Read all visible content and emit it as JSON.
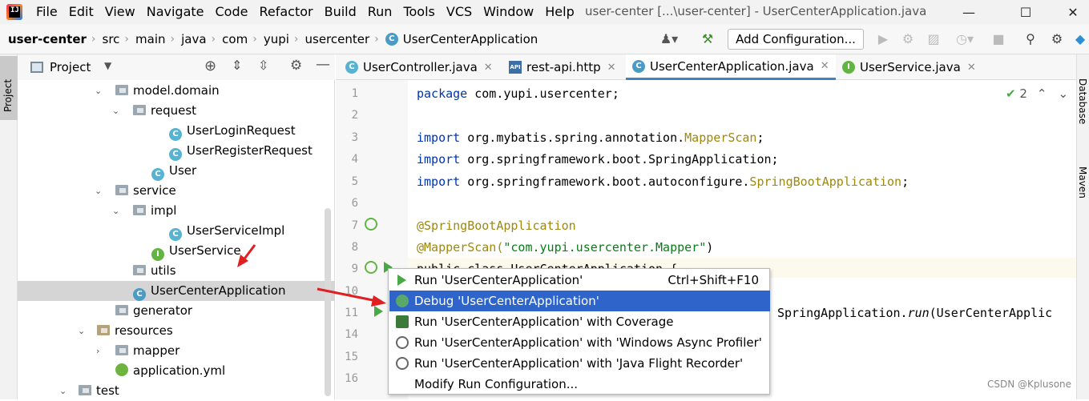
{
  "menubar": {
    "items": [
      "File",
      "Edit",
      "View",
      "Navigate",
      "Code",
      "Refactor",
      "Build",
      "Run",
      "Tools",
      "VCS",
      "Window",
      "Help"
    ],
    "window_title": "user-center [...\\user-center] - UserCenterApplication.java"
  },
  "navbar": {
    "crumbs": [
      "user-center",
      "src",
      "main",
      "java",
      "com",
      "yupi",
      "usercenter",
      "UserCenterApplication"
    ],
    "add_configuration": "Add Configuration..."
  },
  "left_stripe": {
    "project_tab": "Project"
  },
  "project_panel": {
    "title": "Project",
    "tree": [
      {
        "label": "model.domain",
        "icon": "folder-icon",
        "expanded": true
      },
      {
        "label": "request",
        "icon": "folder-icon",
        "expanded": true
      },
      {
        "label": "UserLoginRequest",
        "icon": "class-icon"
      },
      {
        "label": "UserRegisterRequest",
        "icon": "class-icon"
      },
      {
        "label": "User",
        "icon": "class-icon"
      },
      {
        "label": "service",
        "icon": "folder-icon",
        "expanded": true
      },
      {
        "label": "impl",
        "icon": "folder-icon",
        "expanded": true
      },
      {
        "label": "UserServiceImpl",
        "icon": "class-icon"
      },
      {
        "label": "UserService",
        "icon": "interface-icon"
      },
      {
        "label": "utils",
        "icon": "folder-icon"
      },
      {
        "label": "UserCenterApplication",
        "icon": "spring-class-icon",
        "selected": true
      },
      {
        "label": "generator",
        "icon": "folder-icon"
      },
      {
        "label": "resources",
        "icon": "folder-icon",
        "expanded": true
      },
      {
        "label": "mapper",
        "icon": "folder-icon",
        "expanded": false
      },
      {
        "label": "application.yml",
        "icon": "yaml-icon"
      },
      {
        "label": "test",
        "icon": "folder-icon",
        "expanded": true
      }
    ]
  },
  "editor_tabs": [
    {
      "label": "UserController.java",
      "icon": "class-icon"
    },
    {
      "label": "rest-api.http",
      "icon": "api-icon"
    },
    {
      "label": "UserCenterApplication.java",
      "icon": "spring-class-icon",
      "active": true
    },
    {
      "label": "UserService.java",
      "icon": "interface-icon"
    }
  ],
  "editor": {
    "inspections": "2",
    "line_numbers": [
      "1",
      "2",
      "3",
      "4",
      "5",
      "6",
      "7",
      "8",
      "9",
      "10",
      "11",
      "14",
      "15",
      "16"
    ],
    "code": {
      "l1_kw": "package",
      "l1_rest": " com.yupi.usercenter;",
      "l3_kw": "import",
      "l3_a": " org.mybatis.spring.annotation.",
      "l3_b": "MapperScan",
      "l3_c": ";",
      "l4_kw": "import",
      "l4_rest": " org.springframework.boot.SpringApplication;",
      "l5_kw": "import",
      "l5_a": " org.springframework.boot.autoconfigure.",
      "l5_b": "SpringBootApplication",
      "l5_c": ";",
      "l7": "@SpringBootApplication",
      "l8_a": "@MapperScan(",
      "l8_b": "\"com.yupi.usercenter.Mapper\"",
      "l8_c": ")",
      "l9": "public class UserCenterApplication {",
      "l11_a": "SpringApplication.",
      "l11_b": "run",
      "l11_c": "(UserCenterApplic"
    }
  },
  "right_stripe": {
    "tabs": [
      "Database",
      "Maven"
    ]
  },
  "popup": {
    "items": [
      {
        "label": "Run 'UserCenterApplication'",
        "shortcut": "Ctrl+Shift+F10",
        "icon": "run-icon"
      },
      {
        "label": "Debug 'UserCenterApplication'",
        "icon": "debug-icon",
        "selected": true
      },
      {
        "label": "Run 'UserCenterApplication' with Coverage",
        "icon": "coverage-icon"
      },
      {
        "label": "Run 'UserCenterApplication' with 'Windows Async Profiler'",
        "icon": "profiler-icon"
      },
      {
        "label": "Run 'UserCenterApplication' with 'Java Flight Recorder'",
        "icon": "flight-recorder-icon"
      },
      {
        "label": "Modify Run Configuration...",
        "icon": ""
      }
    ]
  },
  "watermark": "CSDN @Kplusone"
}
